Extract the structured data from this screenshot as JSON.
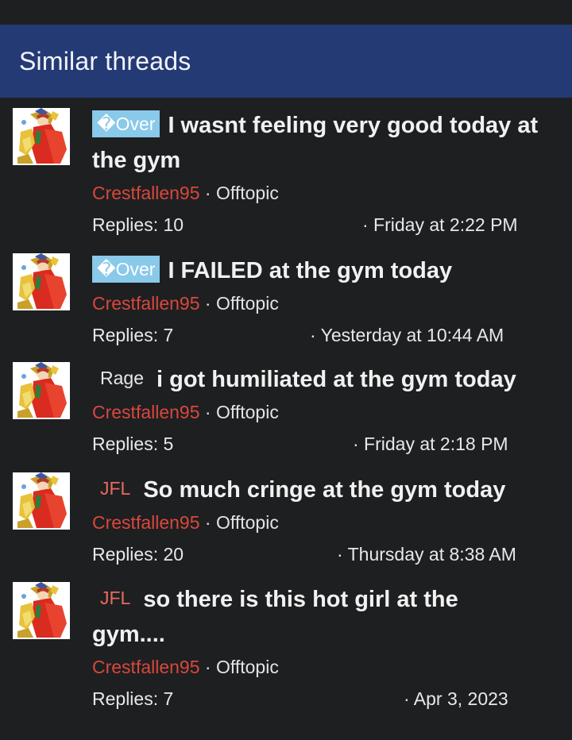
{
  "header": {
    "title": "Similar threads"
  },
  "threads": [
    {
      "prefix": "�Over",
      "title": "I wasnt feeling very good today at the gym",
      "author": "Crestfallen95",
      "separator": "·",
      "forum": "Offtopic",
      "replies": "Replies: 10",
      "date": "· Friday at 2:22 PM"
    },
    {
      "prefix": "�Over",
      "title": "I FAILED at the gym today",
      "author": "Crestfallen95",
      "separator": "·",
      "forum": "Offtopic",
      "replies": "Replies: 7",
      "date": "· Yesterday at 10:44 AM"
    },
    {
      "prefix": "Rage",
      "title": "i got humiliated at the gym today",
      "author": "Crestfallen95",
      "separator": "·",
      "forum": "Offtopic",
      "replies": "Replies: 5",
      "date": "· Friday at 2:18 PM"
    },
    {
      "prefix": "JFL",
      "title": "So much cringe at the gym today",
      "author": "Crestfallen95",
      "separator": "·",
      "forum": "Offtopic",
      "replies": "Replies: 20",
      "date": "· Thursday at 8:38 AM"
    },
    {
      "prefix": "JFL",
      "title": "so there is this hot girl at the gym....",
      "author": "Crestfallen95",
      "separator": "·",
      "forum": "Offtopic",
      "replies": "Replies: 7",
      "date": "· Apr 3, 2023"
    }
  ],
  "colors": {
    "header_bg": "#243a74",
    "page_bg": "#1e1f21",
    "author": "#d9473c",
    "prefix_over_bg": "#89c9e9",
    "prefix_jfl": "#e86a5e"
  },
  "icons": {
    "avatar": "anime-character-avatar"
  }
}
